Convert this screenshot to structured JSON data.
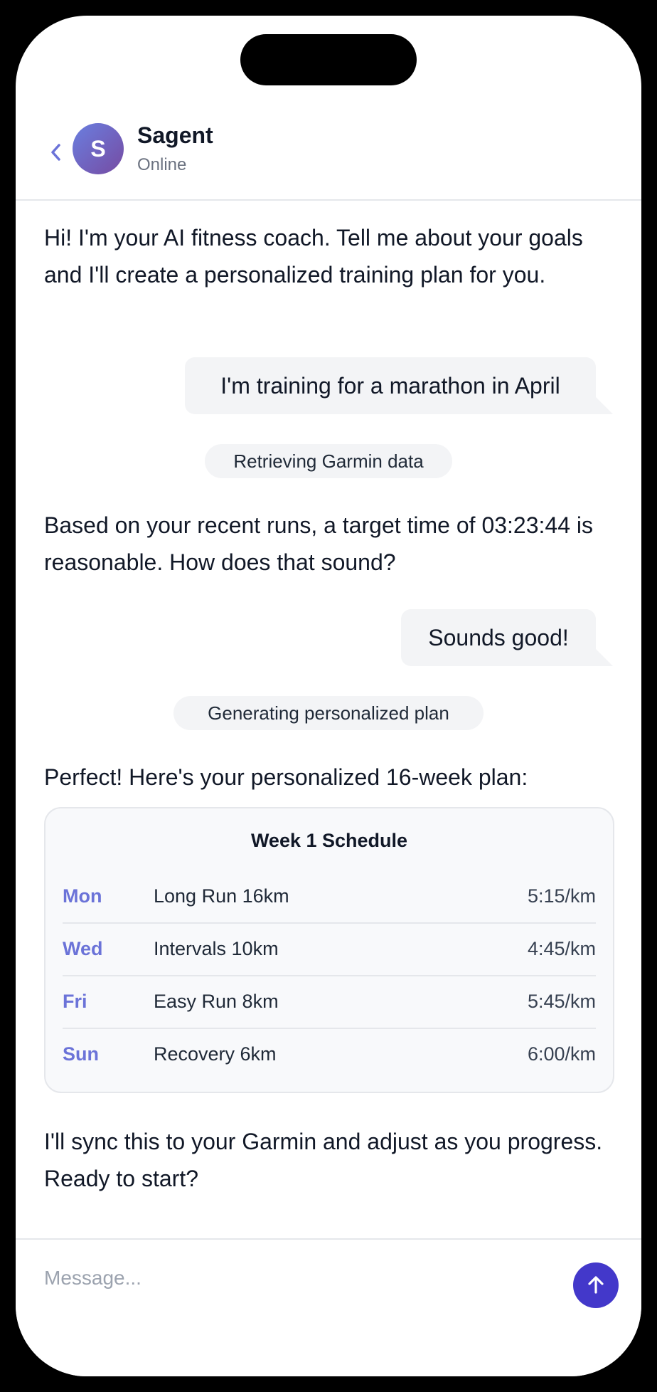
{
  "header": {
    "contact_name": "Sagent",
    "contact_status": "Online",
    "avatar_initial": "S",
    "back_icon": "chevron-left-icon"
  },
  "messages": [
    {
      "role": "ai",
      "text": "Hi! I'm your AI fitness coach. Tell me about your goals and I'll create a personalized training plan for you."
    },
    {
      "role": "user",
      "text": "I'm training for a marathon in April"
    },
    {
      "role": "status",
      "text": "Retrieving Garmin data"
    },
    {
      "role": "ai",
      "text": "Based on your recent runs, a target time of 03:23:44 is reasonable. How does that sound?"
    },
    {
      "role": "user",
      "text": "Sounds good!"
    },
    {
      "role": "status",
      "text": "Generating personalized plan"
    },
    {
      "role": "ai",
      "text": "Perfect! Here's your personalized 16-week plan:"
    },
    {
      "role": "ai",
      "text": "I'll sync this to your Garmin and adjust as you progress. Ready to start?"
    }
  ],
  "schedule": {
    "title": "Week 1 Schedule",
    "rows": [
      {
        "day": "Mon",
        "workout": "Long Run 16km",
        "pace": "5:15/km"
      },
      {
        "day": "Wed",
        "workout": "Intervals 10km",
        "pace": "4:45/km"
      },
      {
        "day": "Fri",
        "workout": "Easy Run 8km",
        "pace": "5:45/km"
      },
      {
        "day": "Sun",
        "workout": "Recovery 6km",
        "pace": "6:00/km"
      }
    ]
  },
  "composer": {
    "placeholder": "Message...",
    "send_icon": "arrow-up-icon"
  },
  "colors": {
    "accent": "#6b73d8",
    "send_button": "#4338ca",
    "bubble_bg": "#f3f4f6",
    "avatar_gradient_start": "#6a7fe0",
    "avatar_gradient_end": "#764ba2"
  }
}
